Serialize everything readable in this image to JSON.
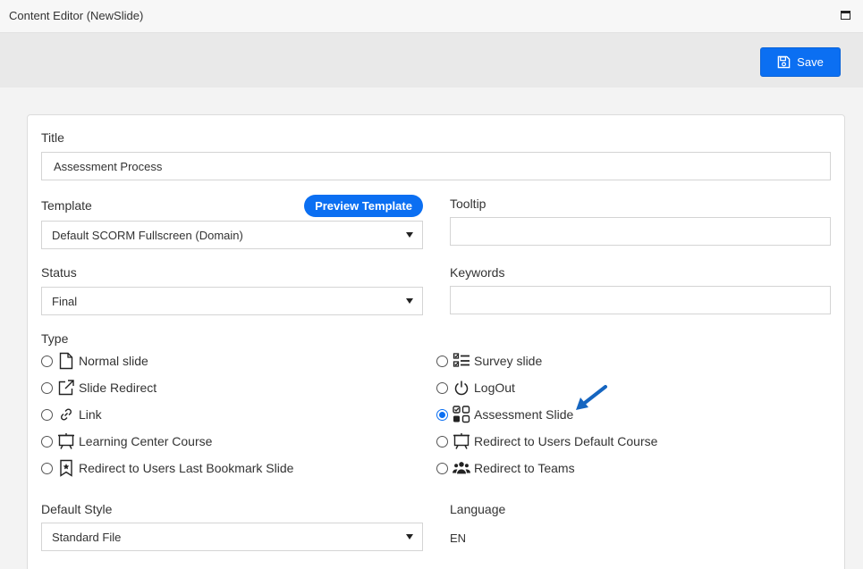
{
  "window": {
    "title": "Content Editor (NewSlide)"
  },
  "toolbar": {
    "save_label": "Save",
    "save_icon": "floppy-disk-icon"
  },
  "form": {
    "title_label": "Title",
    "title_value": "Assessment Process",
    "template_label": "Template",
    "template_value": "Default SCORM Fullscreen (Domain)",
    "preview_label": "Preview Template",
    "tooltip_label": "Tooltip",
    "tooltip_value": "",
    "status_label": "Status",
    "status_value": "Final",
    "keywords_label": "Keywords",
    "keywords_value": "",
    "type_label": "Type",
    "types_left": [
      {
        "label": "Normal slide",
        "icon": "file-icon",
        "checked": false
      },
      {
        "label": "Slide Redirect",
        "icon": "external-link-icon",
        "checked": false
      },
      {
        "label": "Link",
        "icon": "link-icon",
        "checked": false
      },
      {
        "label": "Learning Center Course",
        "icon": "easel-icon",
        "checked": false
      },
      {
        "label": "Redirect to Users Last Bookmark Slide",
        "icon": "bookmark-star-icon",
        "checked": false
      }
    ],
    "types_right": [
      {
        "label": "Survey slide",
        "icon": "checklist-icon",
        "checked": false
      },
      {
        "label": "LogOut",
        "icon": "power-icon",
        "checked": false
      },
      {
        "label": "Assessment Slide",
        "icon": "assessment-grid-icon",
        "checked": true
      },
      {
        "label": "Redirect to Users Default Course",
        "icon": "easel-icon",
        "checked": false
      },
      {
        "label": "Redirect to Teams",
        "icon": "users-icon",
        "checked": false
      }
    ],
    "default_style_label": "Default Style",
    "default_style_value": "Standard File",
    "language_label": "Language",
    "language_value": "EN"
  },
  "colors": {
    "accent": "#0b6ff2",
    "annotation_arrow": "#1565c0"
  }
}
